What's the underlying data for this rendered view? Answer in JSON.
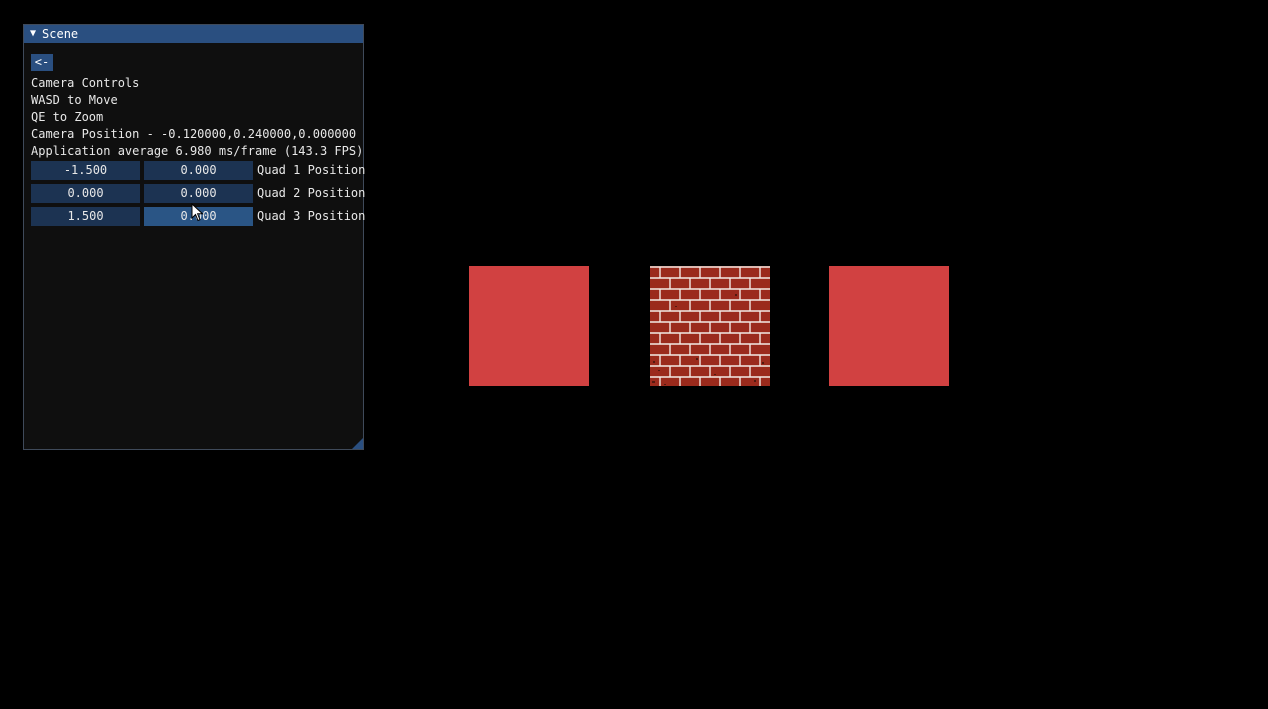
{
  "window": {
    "title": "Scene",
    "back_label": "<-"
  },
  "info": {
    "line1": "Camera Controls",
    "line2": "WASD to Move",
    "line3": "QE to Zoom",
    "camera_position": "Camera Position - -0.120000,0.240000,0.000000",
    "perf": "Application average 6.980 ms/frame (143.3 FPS)"
  },
  "quads": [
    {
      "x": "-1.500",
      "y": "0.000",
      "label": "Quad 1 Position"
    },
    {
      "x": "0.000",
      "y": "0.000",
      "label": "Quad 2 Position"
    },
    {
      "x": "1.500",
      "y": "0.000",
      "label": "Quad 3 Position"
    }
  ],
  "colors": {
    "accent": "#2a4f80",
    "quad_red": "#d14141",
    "brick": "#9b2a1c"
  }
}
